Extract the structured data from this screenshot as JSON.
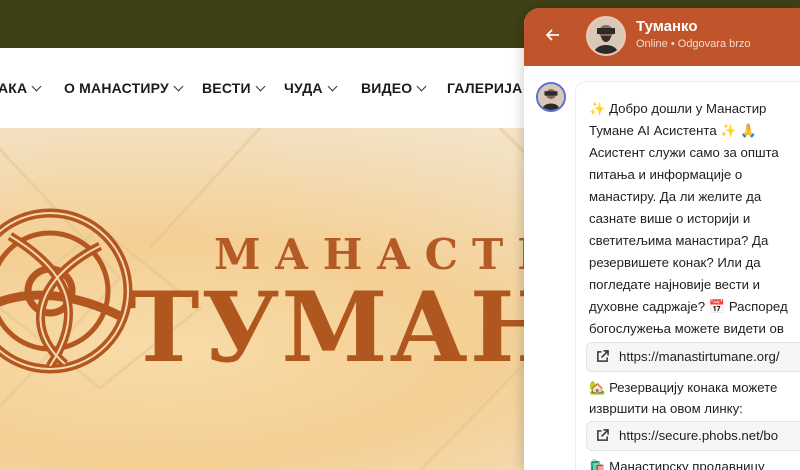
{
  "site": {
    "nav": [
      {
        "label": "АКА"
      },
      {
        "label": "О МАНАСТИРУ"
      },
      {
        "label": "ВЕСТИ"
      },
      {
        "label": "ЧУДА"
      },
      {
        "label": "ВИДЕО"
      },
      {
        "label": "ГАЛЕРИЈА"
      }
    ],
    "logo_top": "МАНАСТИР",
    "logo_main": "ТУМАНЕ",
    "colors": {
      "topbar": "#404016",
      "logo": "#b0571f"
    }
  },
  "chat": {
    "name": "Туманко",
    "status": "Online • Odgovara brzo",
    "header_color": "#c0552b",
    "message_lines": [
      "✨ Добро дошли у Манастир",
      "Тумане AI Асистента ✨ 🙏",
      "Асистент служи само за општа",
      "питања и информације о",
      "манастиру.  Да ли желите да",
      "сазнате више о историји и",
      "светитељима манастира? Да",
      "резервишете конак? Или да",
      "погледате најновије вести и",
      "духовне садржаје?  📅 Распоред",
      "богослужења можете видети ов"
    ],
    "link1": "https://manastirtumane.org/",
    "after_link1": [
      "🏡 Резервацију конака можете",
      "извршити на овом линку:"
    ],
    "link2": "https://secure.phobs.net/bo",
    "after_link2": "🛍️ Манастирску продавницу"
  }
}
